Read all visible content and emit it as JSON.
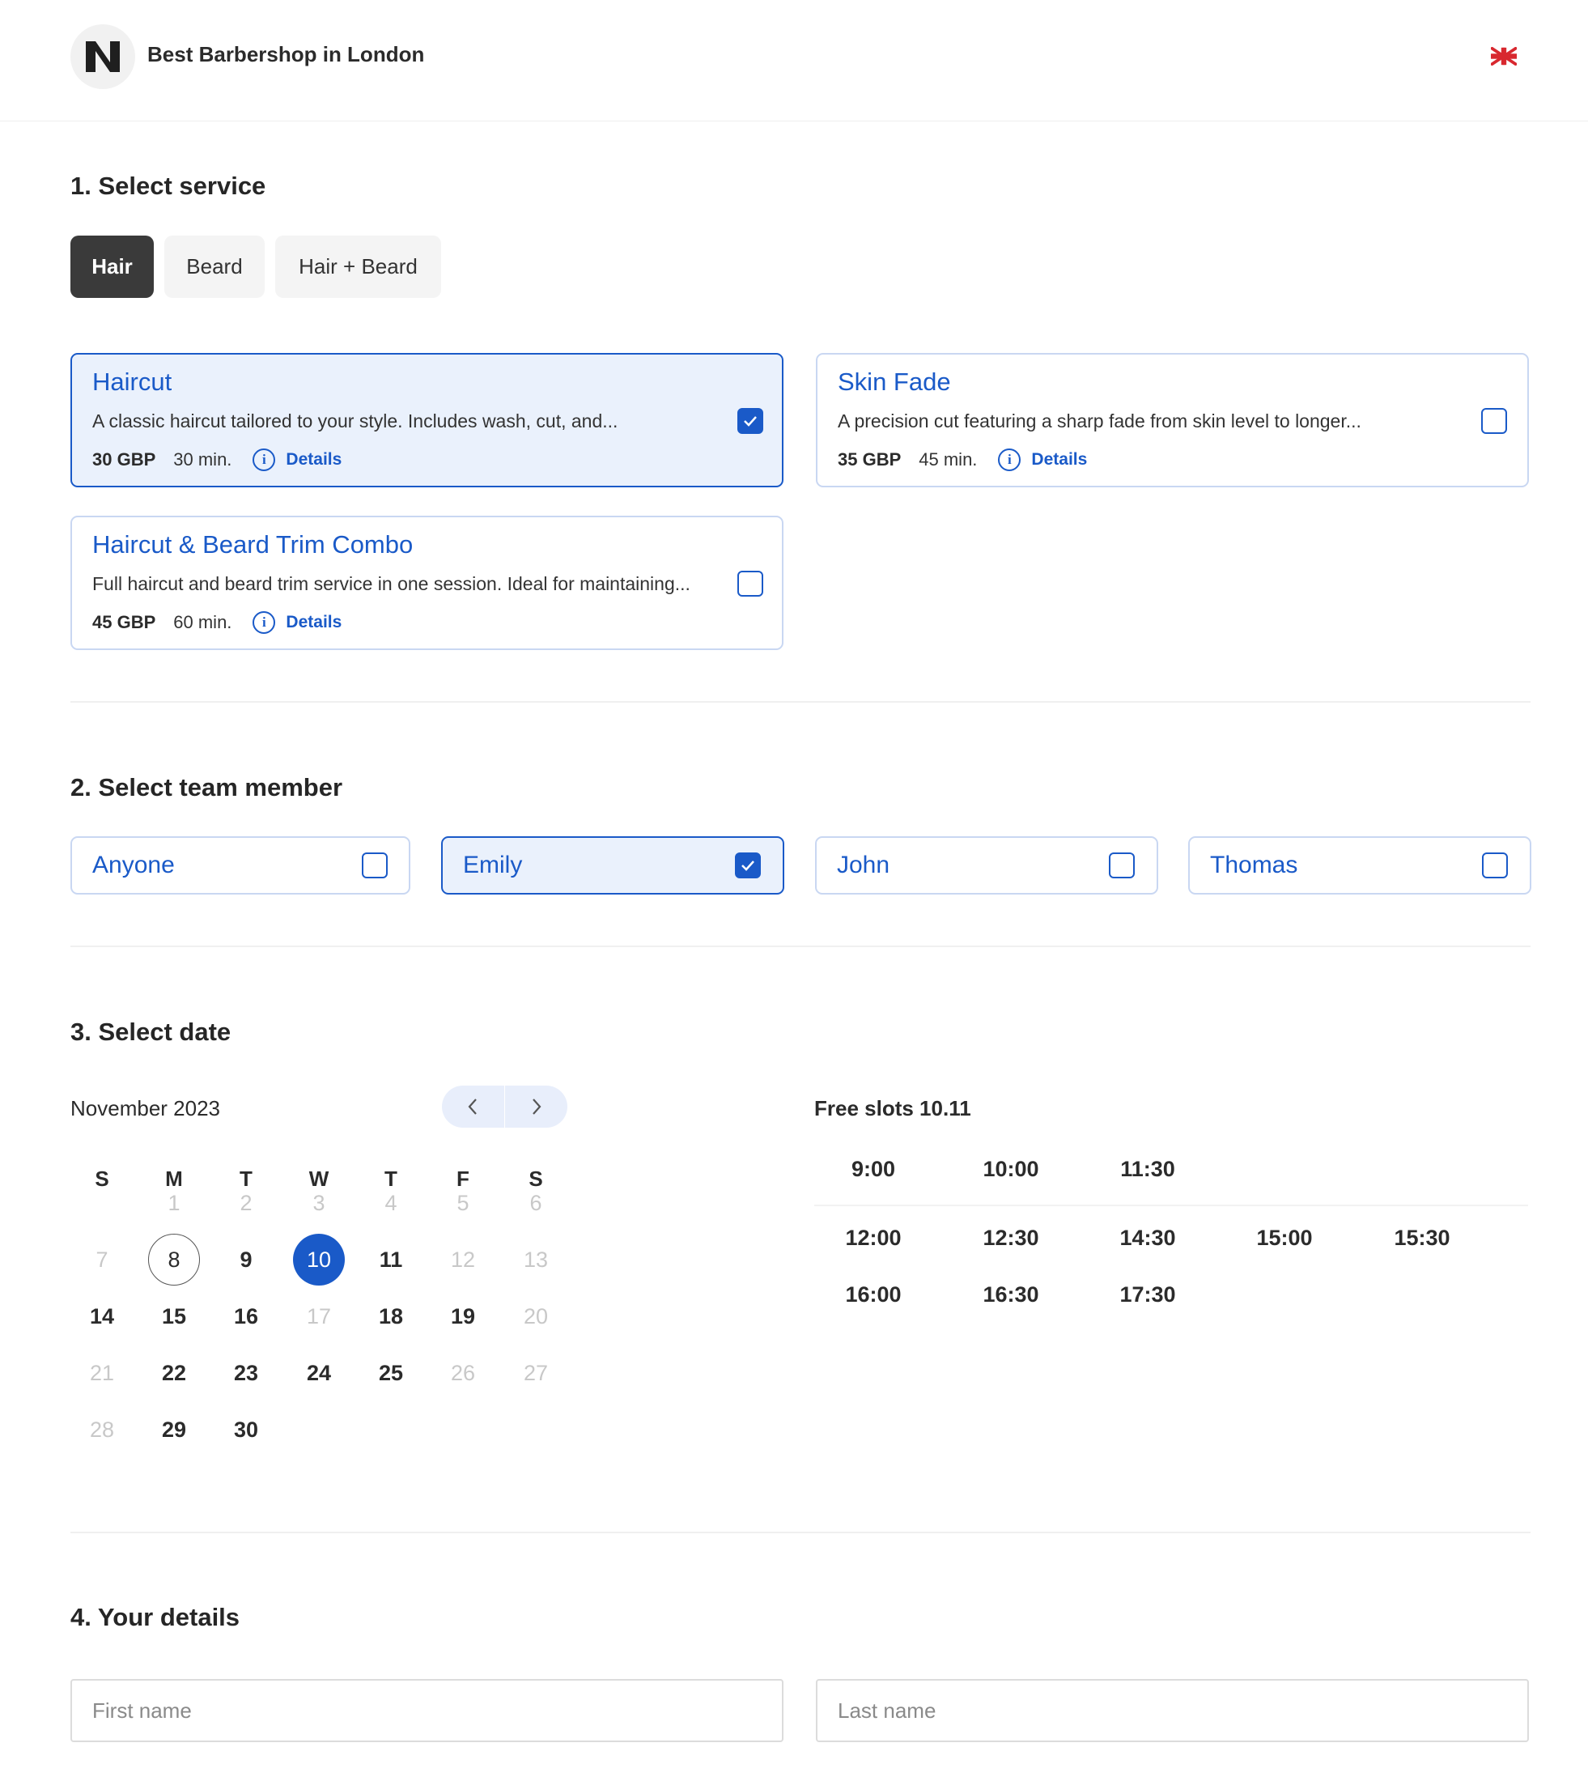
{
  "header": {
    "brand": "Best Barbershop in London",
    "logo_icon": "n-logo-icon",
    "language_icon": "uk-flag-icon"
  },
  "sections": {
    "service": "1. Select service",
    "team": "2. Select team member",
    "date": "3. Select date",
    "details": "4. Your details"
  },
  "service_tabs": [
    {
      "label": "Hair",
      "active": true
    },
    {
      "label": "Beard",
      "active": false
    },
    {
      "label": "Hair + Beard",
      "active": false
    }
  ],
  "services": [
    {
      "title": "Haircut",
      "description": "A classic haircut tailored to your style. Includes wash, cut, and...",
      "price": "30 GBP",
      "duration": "30 min.",
      "details_label": "Details",
      "selected": true
    },
    {
      "title": "Skin Fade",
      "description": "A precision cut featuring a sharp fade from skin level to longer...",
      "price": "35 GBP",
      "duration": "45 min.",
      "details_label": "Details",
      "selected": false
    },
    {
      "title": "Haircut & Beard Trim Combo",
      "description": "Full haircut and beard trim service in one session. Ideal for maintaining...",
      "price": "45 GBP",
      "duration": "60 min.",
      "details_label": "Details",
      "selected": false
    }
  ],
  "team_members": [
    {
      "name": "Anyone",
      "selected": false
    },
    {
      "name": "Emily",
      "selected": true
    },
    {
      "name": "John",
      "selected": false
    },
    {
      "name": "Thomas",
      "selected": false
    }
  ],
  "calendar": {
    "month_label": "November 2023",
    "weekdays": [
      "S",
      "M",
      "T",
      "W",
      "T",
      "F",
      "S"
    ],
    "today": "8",
    "selected": "10",
    "disabled_days": [
      "1",
      "2",
      "3",
      "4",
      "5",
      "6",
      "7",
      "12",
      "13",
      "17",
      "20",
      "21",
      "26",
      "27",
      "28"
    ],
    "days": [
      "1",
      "2",
      "3",
      "4",
      "5",
      "6",
      "7",
      "8",
      "9",
      "10",
      "11",
      "12",
      "13",
      "14",
      "15",
      "16",
      "17",
      "18",
      "19",
      "20",
      "21",
      "22",
      "23",
      "24",
      "25",
      "26",
      "27",
      "28",
      "29",
      "30"
    ]
  },
  "free_slots": {
    "title": "Free slots 10.11",
    "morning": [
      "9:00",
      "10:00",
      "11:30"
    ],
    "afternoon": [
      "12:00",
      "12:30",
      "14:30",
      "15:00",
      "15:30",
      "16:00",
      "16:30",
      "17:30"
    ]
  },
  "form": {
    "first_name": {
      "placeholder": "First name",
      "value": ""
    },
    "last_name": {
      "placeholder": "Last name",
      "value": ""
    }
  },
  "colors": {
    "accent": "#1a5ac8",
    "selected_bg": "#eaf1fc",
    "tab_active": "#3a3a3a"
  }
}
